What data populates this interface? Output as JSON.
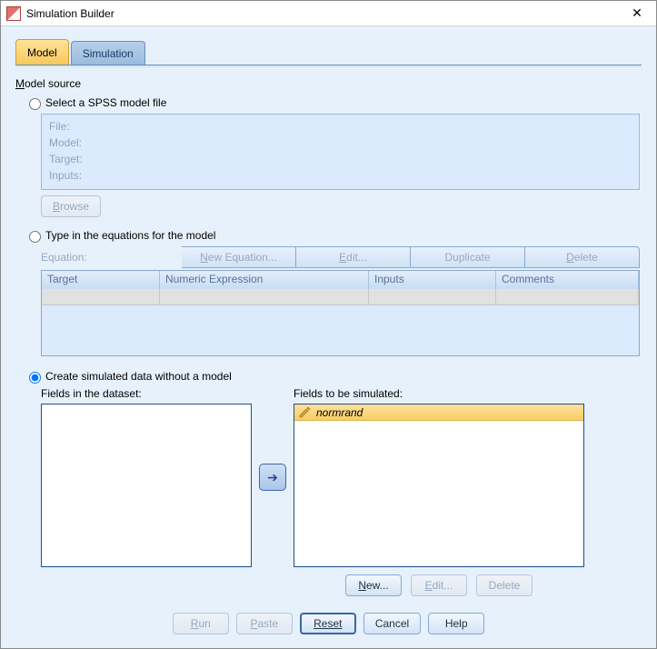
{
  "window": {
    "title": "Simulation Builder"
  },
  "tabs": {
    "model": "Model",
    "simulation": "Simulation"
  },
  "section": {
    "model_source_prefix": "M",
    "model_source_rest": "odel source"
  },
  "opt1": {
    "label": "Select a SPSS model file",
    "file": "File:",
    "model": "Model:",
    "target": "Target:",
    "inputs": "Inputs:",
    "browse_prefix": "B",
    "browse_rest": "rowse"
  },
  "opt2": {
    "label": "Type in the equations for the model",
    "equation_label": "Equation:",
    "btn_new_prefix": "N",
    "btn_new_rest": "ew Equation...",
    "btn_edit_prefix": "E",
    "btn_edit_rest": "dit...",
    "btn_dup": "Duplicate",
    "btn_del_prefix": "D",
    "btn_del_rest": "elete",
    "cols": {
      "target": "Target",
      "expr": "Numeric Expression",
      "inputs": "Inputs",
      "comments": "Comments"
    }
  },
  "opt3": {
    "label": "Create simulated data without a model",
    "left_label": "Fields in the dataset:",
    "right_label": "Fields to be simulated:",
    "items": [
      {
        "name": "normrand"
      }
    ],
    "btn_new_prefix": "N",
    "btn_new_rest": "ew...",
    "btn_edit_prefix": "E",
    "btn_edit_rest": "dit...",
    "btn_delete": "Delete"
  },
  "footer": {
    "run_prefix": "R",
    "run_rest": "un",
    "paste_prefix": "P",
    "paste_rest": "aste",
    "reset": "Reset",
    "cancel": "Cancel",
    "help": "Help"
  }
}
